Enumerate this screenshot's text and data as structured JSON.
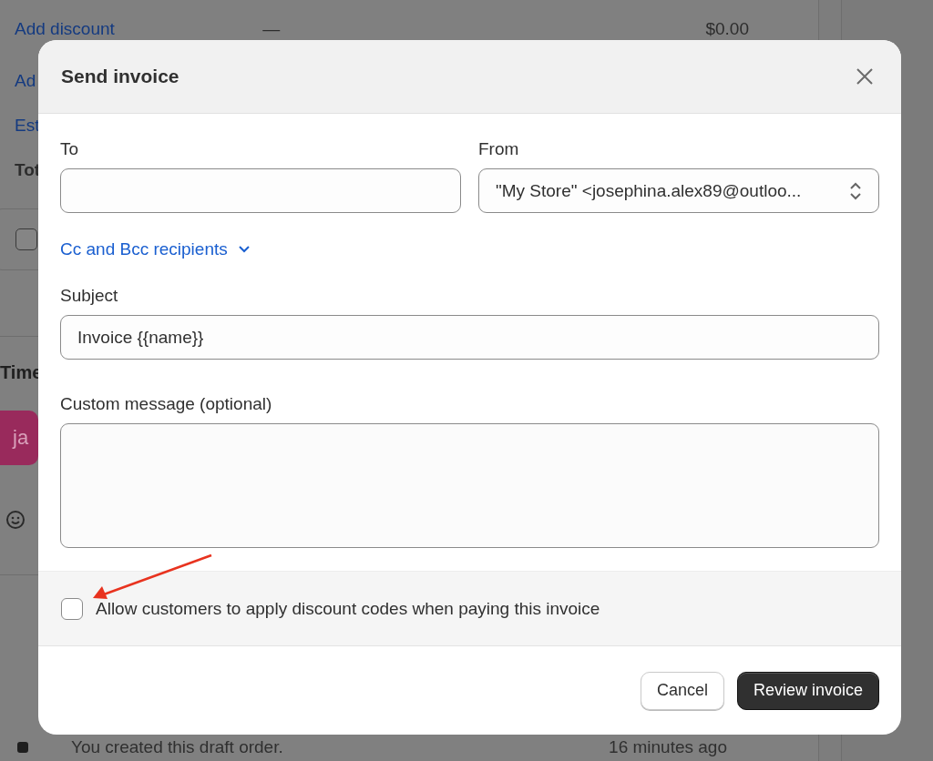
{
  "background": {
    "summary_rows": [
      {
        "kind": "link",
        "label": "Add discount",
        "column_2": "—",
        "column_3": "$0.00"
      },
      {
        "kind": "link",
        "label": "Ad"
      },
      {
        "kind": "link",
        "label": "Est"
      },
      {
        "kind": "total",
        "label": "Tot"
      }
    ],
    "checkbox_card": {
      "checked": false
    },
    "timeline": {
      "title": "Time",
      "avatar": "ja",
      "entries": [
        {
          "text": "You created this draft order.",
          "time": "16 minutes ago"
        }
      ]
    }
  },
  "dialog": {
    "title": "Send invoice",
    "to": {
      "label": "To"
    },
    "from": {
      "label": "From",
      "value": "\"My Store\" <josephina.alex89@outloo..."
    },
    "cc_link": {
      "label": "Cc and Bcc recipients",
      "expanded": false
    },
    "subject": {
      "label": "Subject",
      "value": "Invoice {{name}}"
    },
    "message": {
      "label": "Custom message (optional)"
    },
    "discount_option": {
      "label": "Allow customers to apply discount codes when paying this invoice",
      "checked": false
    },
    "buttons": [
      {
        "kind": "secondary",
        "label": "Cancel"
      },
      {
        "kind": "primary",
        "label": "Review invoice"
      }
    ]
  }
}
